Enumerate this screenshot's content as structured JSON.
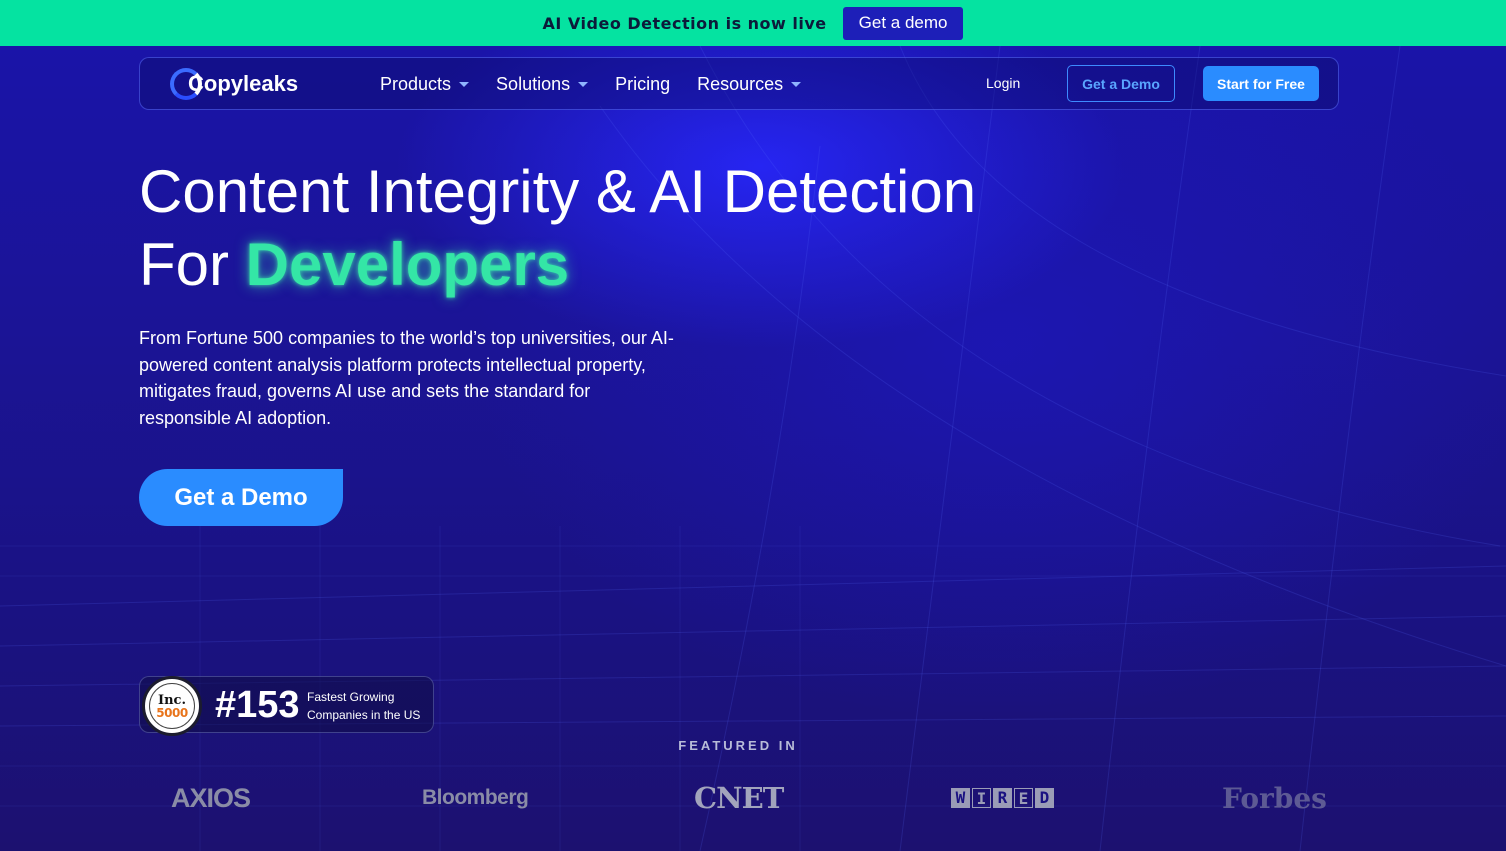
{
  "announcement": {
    "text": "AI Video Detection is now live",
    "button_label": "Get a demo",
    "background_color": "#05e3a1"
  },
  "nav": {
    "logo_text": "Copyleaks",
    "menu": [
      {
        "label": "Products",
        "has_dropdown": true
      },
      {
        "label": "Solutions",
        "has_dropdown": true
      },
      {
        "label": "Pricing",
        "has_dropdown": false
      },
      {
        "label": "Resources",
        "has_dropdown": true
      }
    ],
    "login_label": "Login",
    "demo_label": "Get a Demo",
    "start_label": "Start for Free"
  },
  "hero": {
    "headline_line1": "Content Integrity & AI Detection",
    "headline_line2_prefix": "For ",
    "headline_highlight": "Developers",
    "subtext": "From Fortune 500 companies to the world’s top universities, our AI-powered content analysis platform protects intellectual property, mitigates fraud, governs AI use and sets the standard for responsible AI adoption.",
    "cta_label": "Get a Demo",
    "accent_color": "#2a8cff",
    "highlight_color": "#34e6a6"
  },
  "badge": {
    "seal_word": "Inc.",
    "seal_number": "5000",
    "rank": "#153",
    "label_line1": "Fastest Growing",
    "label_line2": "Companies in the US"
  },
  "featured": {
    "title": "FEATURED IN",
    "logos": [
      "AXIOS",
      "Bloomberg",
      "CNET",
      "WIRED",
      "Forbes"
    ]
  }
}
